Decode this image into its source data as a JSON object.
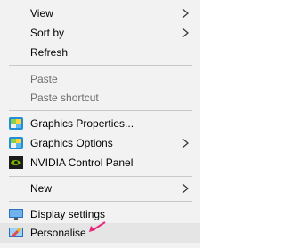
{
  "menu": {
    "items": [
      {
        "label": "View",
        "submenu": true,
        "disabled": false
      },
      {
        "label": "Sort by",
        "submenu": true,
        "disabled": false
      },
      {
        "label": "Refresh",
        "submenu": false,
        "disabled": false
      },
      {
        "label": "Paste",
        "submenu": false,
        "disabled": true
      },
      {
        "label": "Paste shortcut",
        "submenu": false,
        "disabled": true
      },
      {
        "label": "Graphics Properties...",
        "icon": "intel-graphics-icon",
        "submenu": false,
        "disabled": false
      },
      {
        "label": "Graphics Options",
        "icon": "intel-graphics-icon",
        "submenu": true,
        "disabled": false
      },
      {
        "label": "NVIDIA Control Panel",
        "icon": "nvidia-icon",
        "submenu": false,
        "disabled": false
      },
      {
        "label": "New",
        "submenu": true,
        "disabled": false
      },
      {
        "label": "Display settings",
        "icon": "display-settings-icon",
        "submenu": false,
        "disabled": false
      },
      {
        "label": "Personalise",
        "icon": "personalise-icon",
        "submenu": false,
        "disabled": false,
        "highlighted": true
      }
    ]
  },
  "colors": {
    "menu_background": "#f2f2f2",
    "separator": "#c9c9c9",
    "disabled_text": "#6d6d6d",
    "annotation_arrow": "#e8287a"
  }
}
